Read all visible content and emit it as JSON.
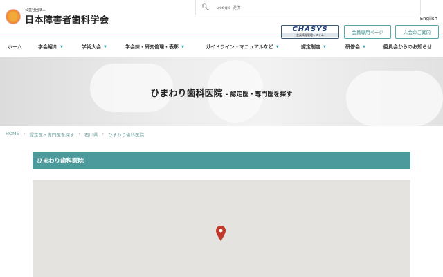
{
  "header": {
    "org_prefix": "公益社団法人",
    "org_name": "日本障害者歯科学会",
    "search_placeholder": "Google 提供",
    "english_link": "English",
    "chasys": {
      "title": "CHASYS",
      "subtitle": "会員情報管理システム"
    },
    "member_page": "会員専用ページ",
    "join": "入会のご案内"
  },
  "nav": [
    {
      "label": "ホーム"
    },
    {
      "label": "学会紹介"
    },
    {
      "label": "学術大会"
    },
    {
      "label": "学会誌・研究倫理・表彰"
    },
    {
      "label": "ガイドライン・マニュアルなど"
    },
    {
      "label": "認定制度"
    },
    {
      "label": "研修会"
    },
    {
      "label": "委員会からのお知らせ"
    }
  ],
  "hero": {
    "title": "ひまわり歯科医院",
    "subtitle": "- 認定医・専門医を探す"
  },
  "breadcrumb": [
    "HOME",
    "認定医・専門医を探す",
    "石川県",
    "ひまわり歯科医院"
  ],
  "clinic": {
    "name": "ひまわり歯科医院"
  },
  "colors": {
    "accent": "#4d9a9c",
    "pin": "#c0392b"
  }
}
